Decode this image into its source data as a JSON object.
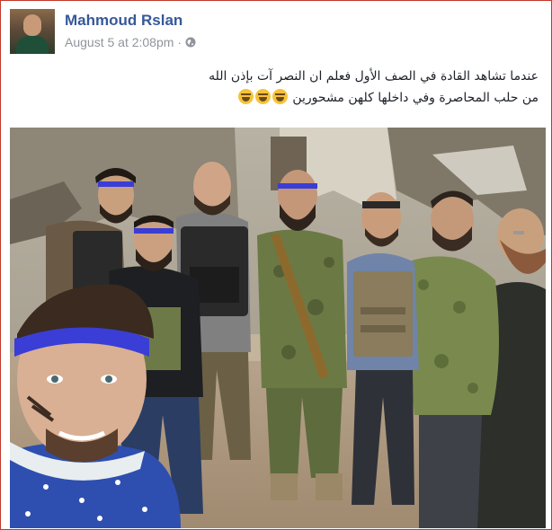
{
  "post": {
    "author": "Mahmoud Rslan",
    "timestamp": "August 5 at 2:08pm",
    "separator": "·",
    "privacy_icon": "globe-icon",
    "caption_line1": "عندما تشاهد القادة في الصف الأول فعلم ان النصر آت بإذن الله",
    "caption_line2": "من حلب المحاصرة وفي داخلها كلهن مشحورين",
    "caption_emojis": [
      "grinning-squinting-face",
      "grinning-squinting-face",
      "grinning-squinting-face"
    ],
    "photo_subject": "group-selfie-photo"
  },
  "colors": {
    "author_link": "#365899",
    "meta_text": "#90949c",
    "frame_border": "#c0392b",
    "headband": "#3a3ed6"
  }
}
